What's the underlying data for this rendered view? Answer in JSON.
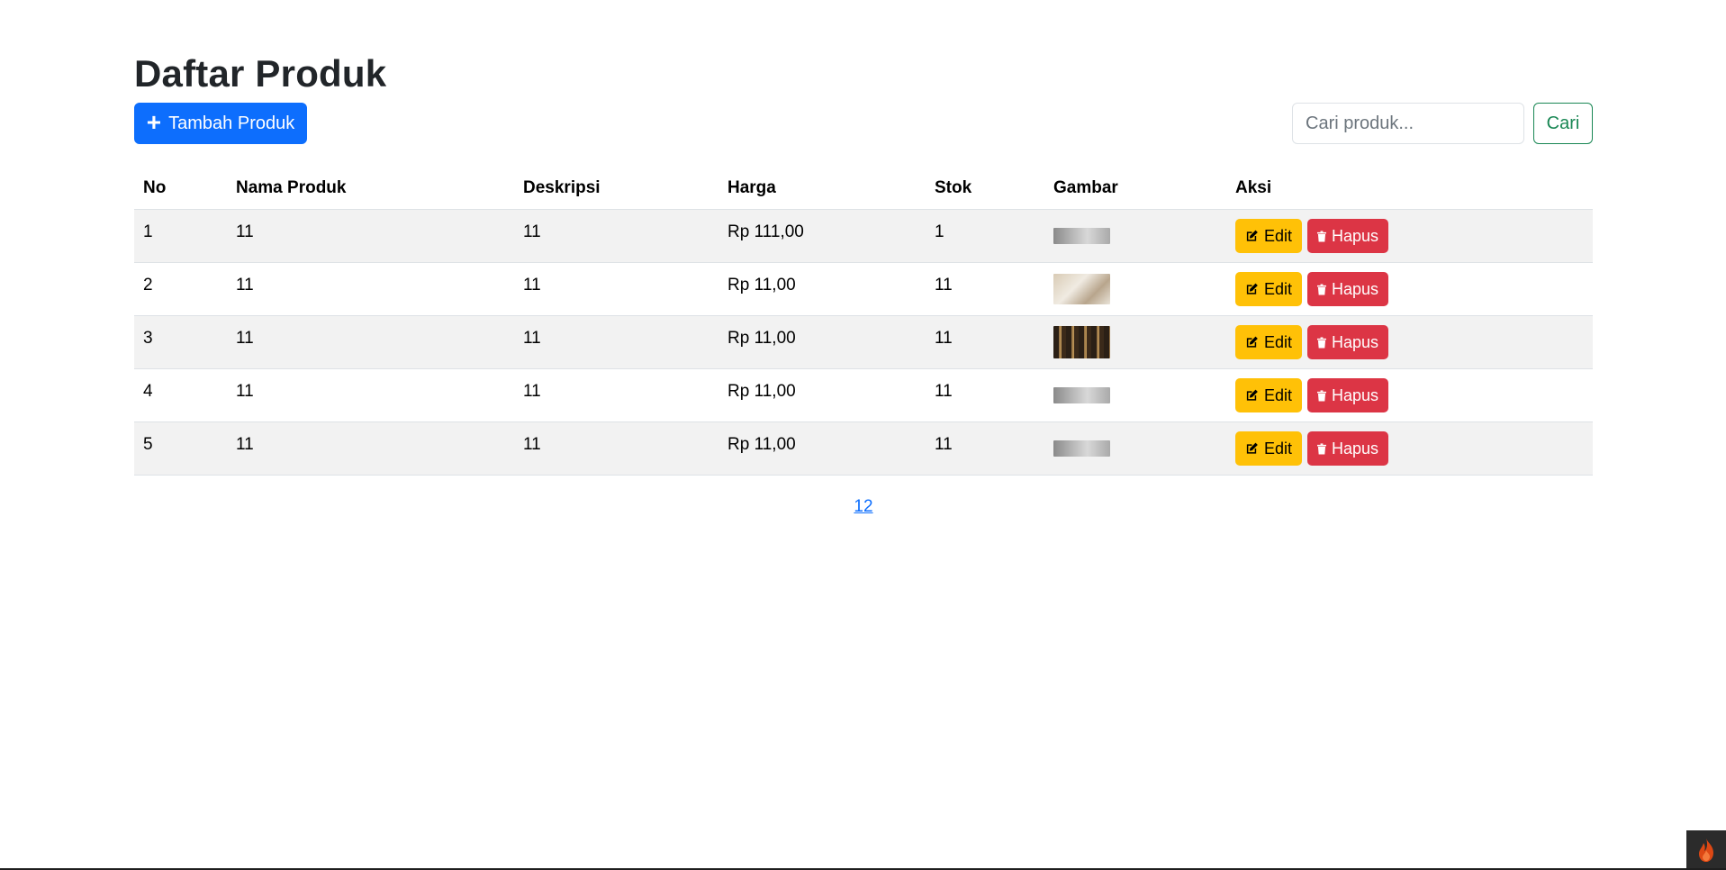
{
  "header": {
    "title": "Daftar Produk"
  },
  "toolbar": {
    "add_label": "Tambah Produk",
    "search_placeholder": "Cari produk...",
    "search_value": "",
    "search_button": "Cari"
  },
  "table": {
    "columns": [
      "No",
      "Nama Produk",
      "Deskripsi",
      "Harga",
      "Stok",
      "Gambar",
      "Aksi"
    ],
    "rows": [
      {
        "no": "1",
        "nama": "11",
        "deskripsi": "11",
        "harga": "Rp 111,00",
        "stok": "1",
        "gambar": "gray-signature-thumbnail"
      },
      {
        "no": "2",
        "nama": "11",
        "deskripsi": "11",
        "harga": "Rp 11,00",
        "stok": "11",
        "gambar": "room-interior-thumbnail"
      },
      {
        "no": "3",
        "nama": "11",
        "deskripsi": "11",
        "harga": "Rp 11,00",
        "stok": "11",
        "gambar": "bookshelf-thumbnail"
      },
      {
        "no": "4",
        "nama": "11",
        "deskripsi": "11",
        "harga": "Rp 11,00",
        "stok": "11",
        "gambar": "gray-signature-thumbnail"
      },
      {
        "no": "5",
        "nama": "11",
        "deskripsi": "11",
        "harga": "Rp 11,00",
        "stok": "11",
        "gambar": "gray-signature-thumbnail"
      }
    ],
    "edit_label": "Edit",
    "delete_label": "Hapus"
  },
  "pagination": {
    "pages": [
      "1",
      "2"
    ]
  },
  "colors": {
    "primary": "#0d6efd",
    "success": "#198754",
    "warning": "#ffc107",
    "danger": "#dc3545",
    "stripe": "#f2f2f2"
  },
  "icons": {
    "add": "plus-icon",
    "edit": "pencil-square-icon",
    "delete": "trash-icon",
    "corner_badge": "flame-icon"
  }
}
